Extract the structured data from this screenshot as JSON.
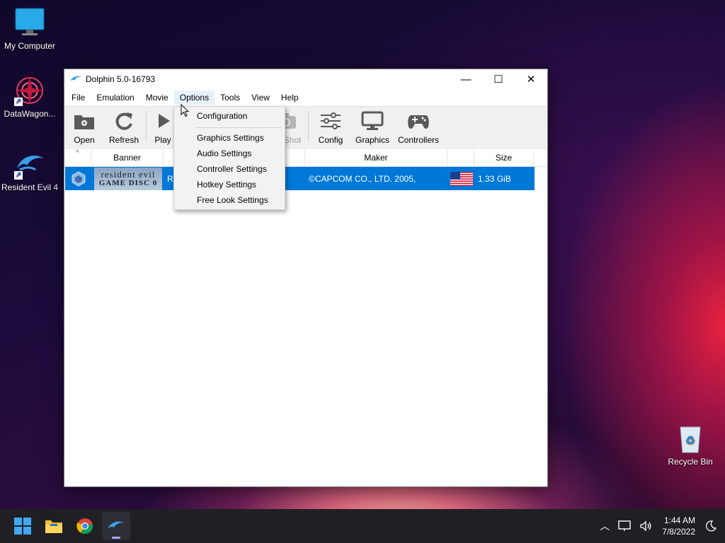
{
  "desktop": {
    "icons": [
      {
        "label": "My Computer"
      },
      {
        "label": "DataWagon..."
      },
      {
        "label": "Resident Evil 4"
      },
      {
        "label": "Recycle Bin"
      }
    ]
  },
  "window": {
    "title": "Dolphin 5.0-16793",
    "controls": {
      "minimize": "—",
      "maximize": "☐",
      "close": "✕"
    },
    "menu": [
      "File",
      "Emulation",
      "Movie",
      "Options",
      "Tools",
      "View",
      "Help"
    ],
    "toolbar": [
      "Open",
      "Refresh",
      "Play",
      "ScrShot",
      "Config",
      "Graphics",
      "Controllers"
    ],
    "columns": {
      "sort": "^",
      "banner": "Banner",
      "maker": "Maker",
      "size": "Size"
    },
    "rows": [
      {
        "banner_text_top": "resident evil",
        "banner_text_bottom": "GAME DISC 0",
        "title_partial": "Re",
        "maker": "©CAPCOM CO., LTD. 2005,",
        "size": "1.33 GiB"
      }
    ]
  },
  "options_menu": {
    "items": [
      "Configuration",
      "Graphics Settings",
      "Audio Settings",
      "Controller Settings",
      "Hotkey Settings",
      "Free Look Settings"
    ]
  },
  "taskbar": {
    "clock_time": "1:44 AM",
    "clock_date": "7/8/2022"
  },
  "colors": {
    "selection": "#0078d7",
    "taskbar": "#1f1f24"
  }
}
